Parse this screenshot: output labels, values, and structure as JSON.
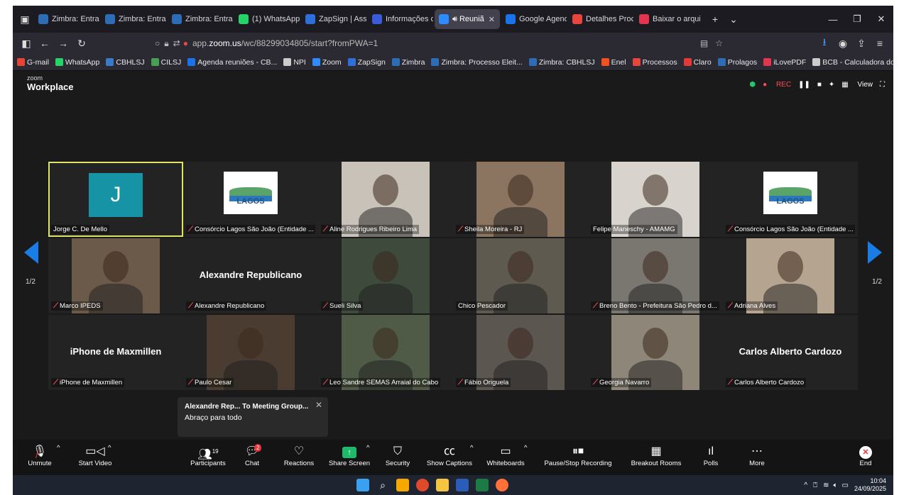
{
  "browser": {
    "tabs": [
      {
        "label": "Zimbra: Entrad",
        "color": "#2d6db5"
      },
      {
        "label": "Zimbra: Entrad",
        "color": "#2d6db5"
      },
      {
        "label": "Zimbra: Entrad",
        "color": "#2d6db5"
      },
      {
        "label": "(1) WhatsApp",
        "color": "#25d366"
      },
      {
        "label": "ZapSign | Assin",
        "color": "#2f6fdb"
      },
      {
        "label": "Informações d",
        "color": "#3b5bdb"
      },
      {
        "label": "Reuniã",
        "color": "#2d8cff",
        "active": true
      },
      {
        "label": "Google Agend",
        "color": "#1a73e8"
      },
      {
        "label": "Detalhes Proce",
        "color": "#e8453c"
      },
      {
        "label": "Baixar o arquiv",
        "color": "#e2364f"
      }
    ],
    "url_prefix": "app.",
    "url_domain": "zoom.us",
    "url_path": "/wc/88299034805/start?fromPWA=1",
    "bookmarks": [
      {
        "label": "G-mail",
        "color": "#ea4335"
      },
      {
        "label": "WhatsApp",
        "color": "#25d366"
      },
      {
        "label": "CBHLSJ",
        "color": "#3a7ac8"
      },
      {
        "label": "CILSJ",
        "color": "#4a9d57"
      },
      {
        "label": "Agenda reuniões - CB...",
        "color": "#1a73e8"
      },
      {
        "label": "NPI",
        "color": "#cccccc"
      },
      {
        "label": "Zoom",
        "color": "#2d8cff"
      },
      {
        "label": "ZapSign",
        "color": "#2f6fdb"
      },
      {
        "label": "Zimbra",
        "color": "#2d6db5"
      },
      {
        "label": "Zimbra: Processo Eleit...",
        "color": "#2d6db5"
      },
      {
        "label": "Zimbra: CBHLSJ",
        "color": "#2d6db5"
      },
      {
        "label": "Enel",
        "color": "#f4511e"
      },
      {
        "label": "Processos",
        "color": "#e8453c"
      },
      {
        "label": "Claro",
        "color": "#e53935"
      },
      {
        "label": "Prolagos",
        "color": "#2d6db5"
      },
      {
        "label": "iLovePDF",
        "color": "#e2364f"
      },
      {
        "label": "BCB - Calculadora do ...",
        "color": "#cccccc"
      }
    ]
  },
  "zoom": {
    "logo_small": "zoom",
    "logo_big": "Workplace",
    "rec_label": "REC",
    "view_label": "View",
    "page_indicator": "1/2",
    "participants": [
      {
        "name": "Jorge C. De Mello",
        "type": "avatar",
        "letter": "J",
        "muted": false,
        "speaking": true
      },
      {
        "name": "Consórcio Lagos São João (Entidade ...",
        "type": "logo",
        "logo_text": "LAGOS",
        "muted": true
      },
      {
        "name": "Aline Rodrigues Ribeiro Lima",
        "type": "video",
        "bg": "#c9c2b8",
        "muted": true
      },
      {
        "name": "Sheila Moreira - RJ",
        "type": "video",
        "bg": "#8b7560",
        "muted": true
      },
      {
        "name": "Felipe Maneschy - AMAMG",
        "type": "video",
        "bg": "#d8d3cc",
        "muted": false
      },
      {
        "name": "Consórcio Lagos São João (Entidade ...",
        "type": "logo",
        "logo_text": "LAGOS",
        "muted": true
      },
      {
        "name": "Marco IPEDS",
        "type": "video",
        "bg": "#6b5a4a",
        "muted": true
      },
      {
        "name": "Alexandre Republicano",
        "type": "name",
        "big_name": "Alexandre Republicano",
        "muted": true
      },
      {
        "name": "Sueli Silva",
        "type": "video",
        "bg": "#3e4a3c",
        "muted": true
      },
      {
        "name": "Chico Pescador",
        "type": "video",
        "bg": "#5f5a50",
        "muted": false
      },
      {
        "name": "Breno Bento - Prefeitura São Pedro d...",
        "type": "video",
        "bg": "#7a7770",
        "muted": true
      },
      {
        "name": "Adriana Alves",
        "type": "video",
        "bg": "#b5a48f",
        "muted": true
      },
      {
        "name": "iPhone de Maxmillen",
        "type": "name",
        "big_name": "iPhone de Maxmillen",
        "muted": true
      },
      {
        "name": "Paulo Cesar",
        "type": "video",
        "bg": "#4a3c30",
        "muted": true
      },
      {
        "name": "Leo Sandre SEMAS Arraial do Cabo",
        "type": "video",
        "bg": "#4f5b46",
        "muted": true
      },
      {
        "name": "Fábio Origuela",
        "type": "video",
        "bg": "#5c5650",
        "muted": true
      },
      {
        "name": "Georgia Navarro",
        "type": "video",
        "bg": "#8e8678",
        "muted": true
      },
      {
        "name": "Carlos Alberto Cardozo",
        "type": "name",
        "big_name": "Carlos Alberto Cardozo",
        "muted": true
      }
    ],
    "chat_popup": {
      "title": "Alexandre Rep... To Meeting Group...",
      "message": "Abraço para todo"
    },
    "toolbar": {
      "unmute": "Unmute",
      "start_video": "Start Video",
      "participants": "Participants",
      "participants_count": "19",
      "chat": "Chat",
      "chat_badge": "2",
      "reactions": "Reactions",
      "share_screen": "Share Screen",
      "security": "Security",
      "show_captions": "Show Captions",
      "whiteboards": "Whiteboards",
      "pause_stop_recording": "Pause/Stop Recording",
      "breakout_rooms": "Breakout Rooms",
      "polls": "Polls",
      "more": "More",
      "end": "End"
    }
  },
  "taskbar": {
    "time": "10:04",
    "date": "24/09/2025"
  }
}
